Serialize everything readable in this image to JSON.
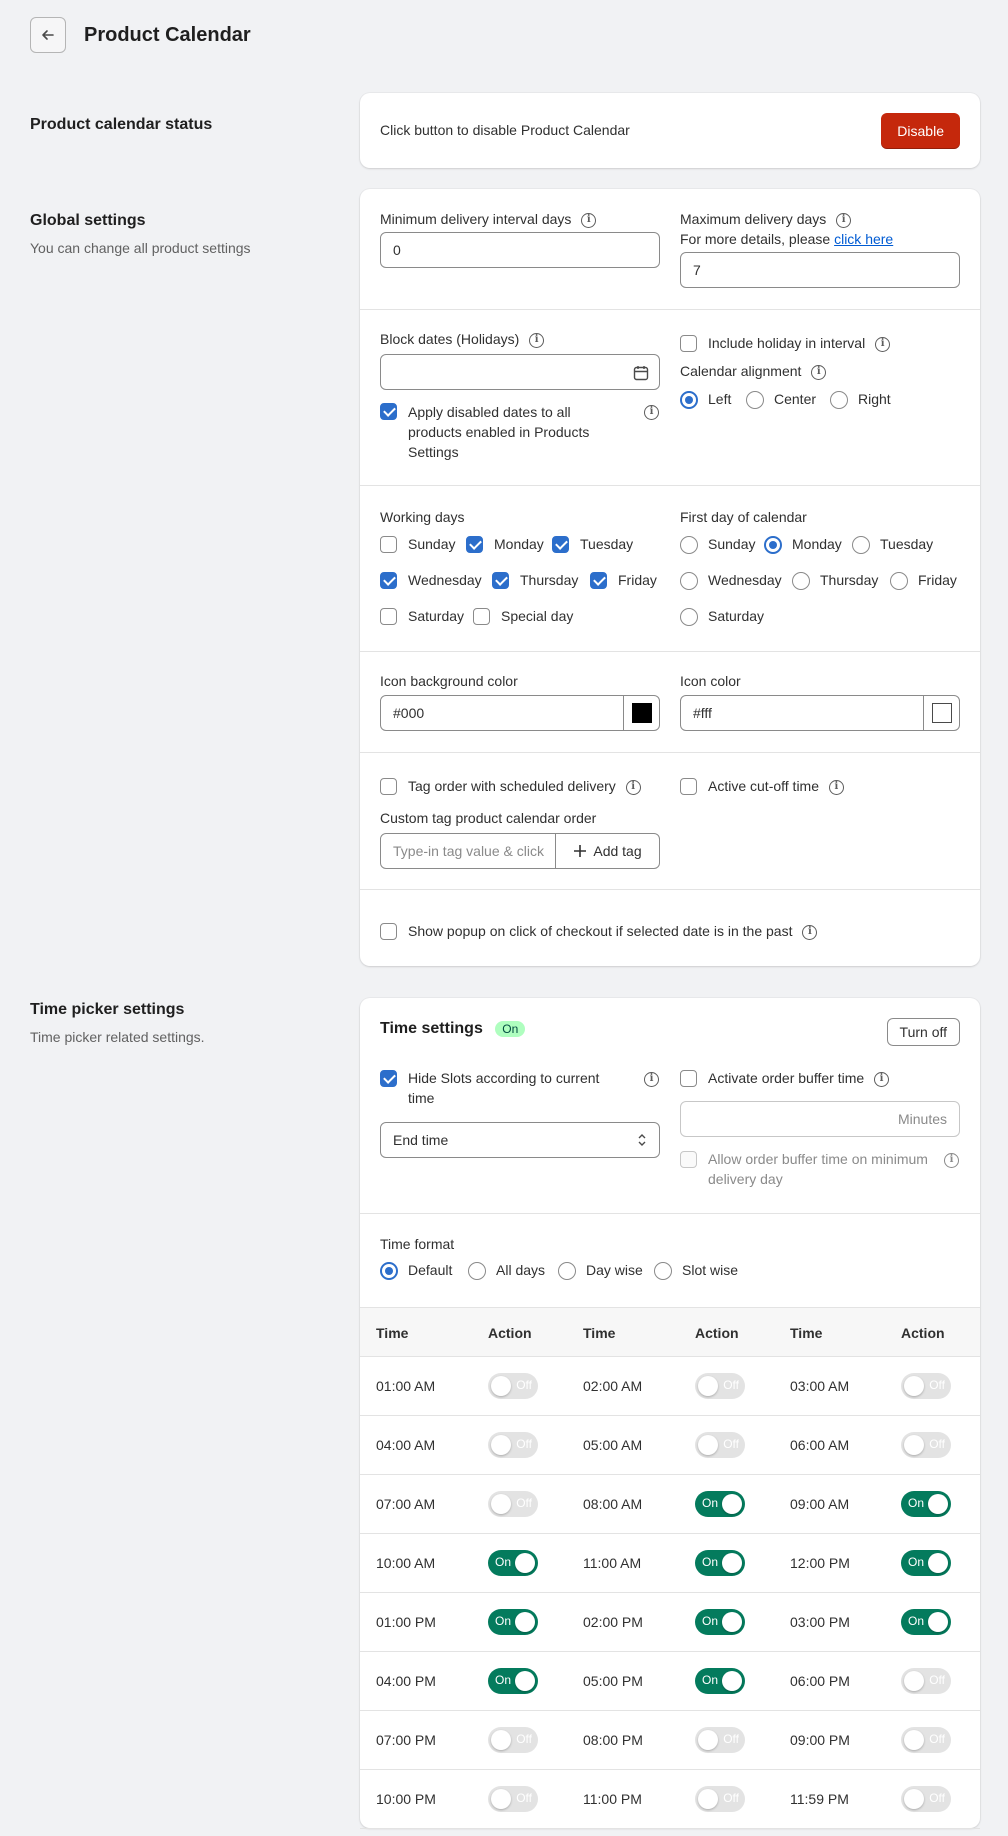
{
  "header": {
    "title": "Product Calendar"
  },
  "status_section": {
    "heading": "Product calendar status",
    "message": "Click button to disable Product Calendar",
    "button": "Disable"
  },
  "global_section": {
    "heading": "Global settings",
    "description": "You can change all product settings",
    "min_delivery_label": "Minimum delivery interval days",
    "min_delivery_value": "0",
    "max_delivery_label": "Maximum delivery days",
    "max_delivery_help": "For more details, please",
    "max_delivery_link": "click here",
    "max_delivery_value": "7",
    "block_dates_label": "Block dates (Holidays)",
    "apply_disabled_label": "Apply disabled dates to all products enabled in Products Settings",
    "include_holiday_label": "Include holiday in interval",
    "calendar_alignment_label": "Calendar alignment",
    "alignment_options": [
      "Left",
      "Center",
      "Right"
    ],
    "working_days_label": "Working days",
    "working_days": [
      "Sunday",
      "Monday",
      "Tuesday",
      "Wednesday",
      "Thursday",
      "Friday",
      "Saturday",
      "Special day"
    ],
    "first_day_label": "First day of calendar",
    "first_day_options": [
      "Sunday",
      "Monday",
      "Tuesday",
      "Wednesday",
      "Thursday",
      "Friday",
      "Saturday"
    ],
    "icon_bg_label": "Icon background color",
    "icon_bg_value": "#000",
    "icon_color_label": "Icon color",
    "icon_color_value": "#fff",
    "tag_order_label": "Tag order with scheduled delivery",
    "active_cutoff_label": "Active cut-off time",
    "custom_tag_label": "Custom tag product calendar order",
    "custom_tag_placeholder": "Type-in tag value & click",
    "add_tag_button": "Add tag",
    "popup_label": "Show popup on click of checkout if selected date is in the past"
  },
  "time_section": {
    "heading": "Time picker settings",
    "description": "Time picker related settings.",
    "card_title": "Time settings",
    "status_badge": "On",
    "turn_off_button": "Turn off",
    "hide_slots_label": "Hide Slots according to current time",
    "end_time_select": "End time",
    "buffer_label": "Activate order buffer time",
    "minutes_placeholder": "Minutes",
    "allow_buffer_label": "Allow order buffer time on minimum delivery day",
    "time_format_label": "Time format",
    "time_format_options": [
      "Default",
      "All days",
      "Day wise",
      "Slot wise"
    ],
    "table_headers": [
      "Time",
      "Action",
      "Time",
      "Action",
      "Time",
      "Action"
    ],
    "toggle_on_text": "On",
    "toggle_off_text": "Off",
    "rows": [
      [
        [
          "01:00 AM",
          false
        ],
        [
          "02:00 AM",
          false
        ],
        [
          "03:00 AM",
          false
        ]
      ],
      [
        [
          "04:00 AM",
          false
        ],
        [
          "05:00 AM",
          false
        ],
        [
          "06:00 AM",
          false
        ]
      ],
      [
        [
          "07:00 AM",
          false
        ],
        [
          "08:00 AM",
          true
        ],
        [
          "09:00 AM",
          true
        ]
      ],
      [
        [
          "10:00 AM",
          true
        ],
        [
          "11:00 AM",
          true
        ],
        [
          "12:00 PM",
          true
        ]
      ],
      [
        [
          "01:00 PM",
          true
        ],
        [
          "02:00 PM",
          true
        ],
        [
          "03:00 PM",
          true
        ]
      ],
      [
        [
          "04:00 PM",
          true
        ],
        [
          "05:00 PM",
          true
        ],
        [
          "06:00 PM",
          false
        ]
      ],
      [
        [
          "07:00 PM",
          false
        ],
        [
          "08:00 PM",
          false
        ],
        [
          "09:00 PM",
          false
        ]
      ],
      [
        [
          "10:00 PM",
          false
        ],
        [
          "11:00 PM",
          false
        ],
        [
          "11:59 PM",
          false
        ]
      ]
    ]
  }
}
